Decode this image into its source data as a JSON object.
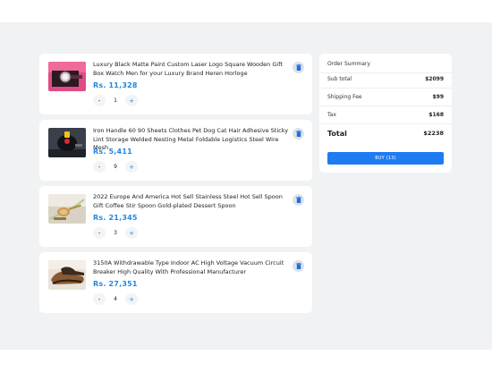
{
  "cart": {
    "items": [
      {
        "title": "Luxury Black Matte Paint Custom Laser Logo Square Wooden Gift Box Watch Men for your Luxury Brand Heren Horloge",
        "price": "Rs. 11,328",
        "quantity": "1",
        "minus_label": "-",
        "plus_label": "+",
        "image": "watch-gift-box-image",
        "delete_icon": "trash-icon"
      },
      {
        "title": "Iron Handle 60 90 Sheets Clothes Pet Dog Cat Hair Adhesive Sticky Lint Storage Welded Nesting Metal Foldable Logistics Steel Wire Mesh",
        "price": "Rs. 5,411",
        "quantity": "9",
        "minus_label": "-",
        "plus_label": "+",
        "image": "lint-roller-image",
        "delete_icon": "trash-icon"
      },
      {
        "title": "2022 Europe And America Hot Sell Stainless Steel Hot Sell Spoon Gift Coffee Stir Spoon Gold-plated Dessert Spoon",
        "price": "Rs. 21,345",
        "quantity": "3",
        "minus_label": "-",
        "plus_label": "+",
        "image": "gold-spoon-image",
        "delete_icon": "trash-icon"
      },
      {
        "title": "3150A Withdrawable Type Indoor AC High Voltage Vacuum Circuit Breaker High Quality With Professional Manufacturer",
        "price": "Rs. 27,351",
        "quantity": "4",
        "minus_label": "-",
        "plus_label": "+",
        "image": "shoes-image",
        "delete_icon": "trash-icon"
      }
    ]
  },
  "summary": {
    "title": "Order Summary",
    "subtotal_label": "Sub total",
    "subtotal_value": "$2099",
    "shipping_label": "Shipping Fee",
    "shipping_value": "$99",
    "tax_label": "Tax",
    "tax_value": "$168",
    "total_label": "Total",
    "total_value": "$2238",
    "buy_label": "BUY (13)"
  },
  "colors": {
    "accent": "#1e88e5",
    "buy_button": "#1e7bf2",
    "page_background": "#f1f2f4",
    "delete_button_bg": "#dbe2ee"
  }
}
